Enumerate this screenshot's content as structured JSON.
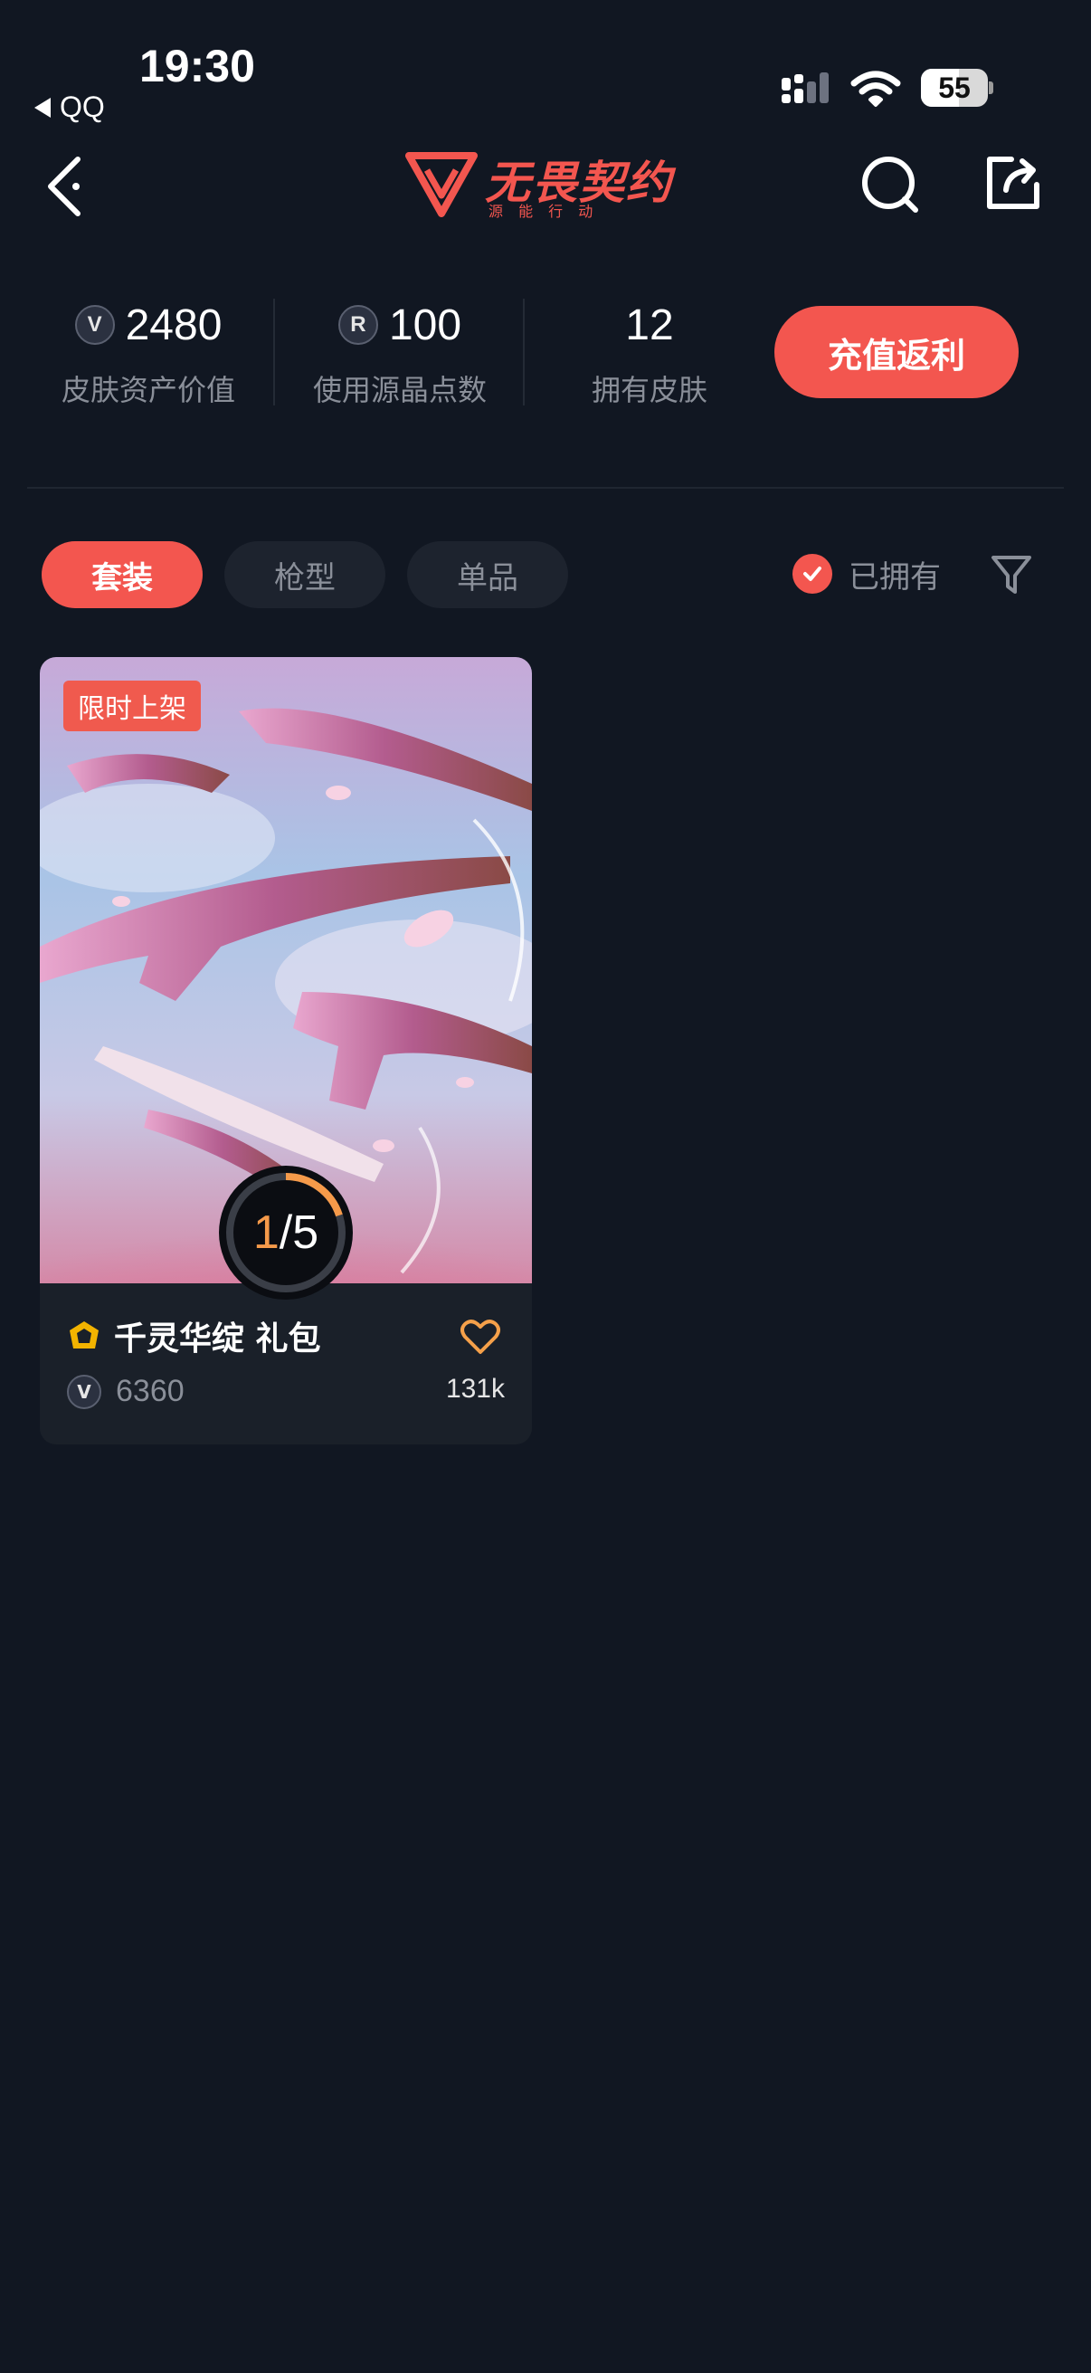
{
  "status_bar": {
    "time": "19:30",
    "back_app": "QQ",
    "battery": "55"
  },
  "header": {
    "logo_text": "无畏契约",
    "logo_subtext": "源 能 行 动",
    "back_icon": "back-arrow-icon",
    "search_icon": "search-icon",
    "share_icon": "share-icon"
  },
  "stats": [
    {
      "value": "2480",
      "label": "皮肤资产价值",
      "icon": "vp-coin-icon",
      "icon_glyph": "V"
    },
    {
      "value": "100",
      "label": "使用源晶点数",
      "icon": "radianite-icon",
      "icon_glyph": "R"
    },
    {
      "value": "12",
      "label": "拥有皮肤"
    }
  ],
  "recharge_button": "充值返利",
  "tabs": [
    {
      "label": "套装",
      "active": true
    },
    {
      "label": "枪型",
      "active": false
    },
    {
      "label": "单品",
      "active": false
    }
  ],
  "owned_filter": {
    "label": "已拥有",
    "checked": true
  },
  "cards": [
    {
      "badge": "限时上架",
      "progress_current": "1",
      "progress_total": "5",
      "progress_fraction": 0.2,
      "name": "千灵华绽 礼包",
      "price": "6360",
      "likes": "131k",
      "price_icon": "V"
    }
  ],
  "colors": {
    "background": "#111722",
    "accent": "#f3564f",
    "muted_text": "#8a8f99",
    "progress": "#f59a4a",
    "heart": "#f5a04a"
  }
}
